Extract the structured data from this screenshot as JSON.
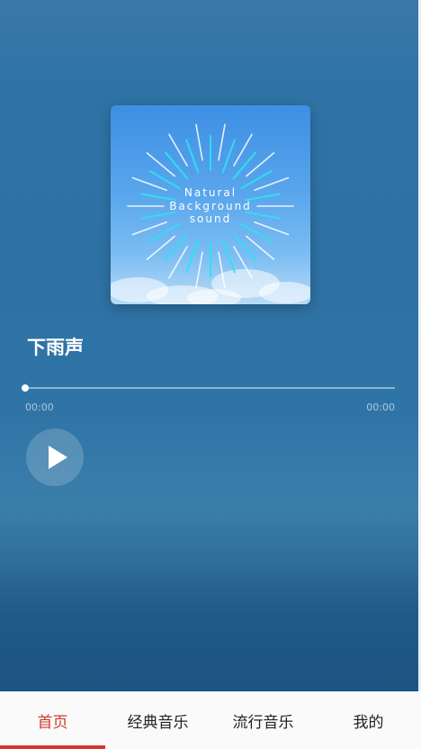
{
  "player": {
    "cover": {
      "line1": "Natural",
      "line2": "Background",
      "line3": "sound",
      "icon": "sunburst-rays"
    },
    "title": "下雨声",
    "progress": {
      "current_time": "00:00",
      "total_time": "00:00",
      "fraction": 0
    },
    "play_button": {
      "icon": "play-icon",
      "state": "paused"
    }
  },
  "tabbar": {
    "tabs": [
      {
        "label": "首页",
        "active": true
      },
      {
        "label": "经典音乐",
        "active": false
      },
      {
        "label": "流行音乐",
        "active": false
      },
      {
        "label": "我的",
        "active": false
      }
    ],
    "active_color": "#d0392b"
  }
}
